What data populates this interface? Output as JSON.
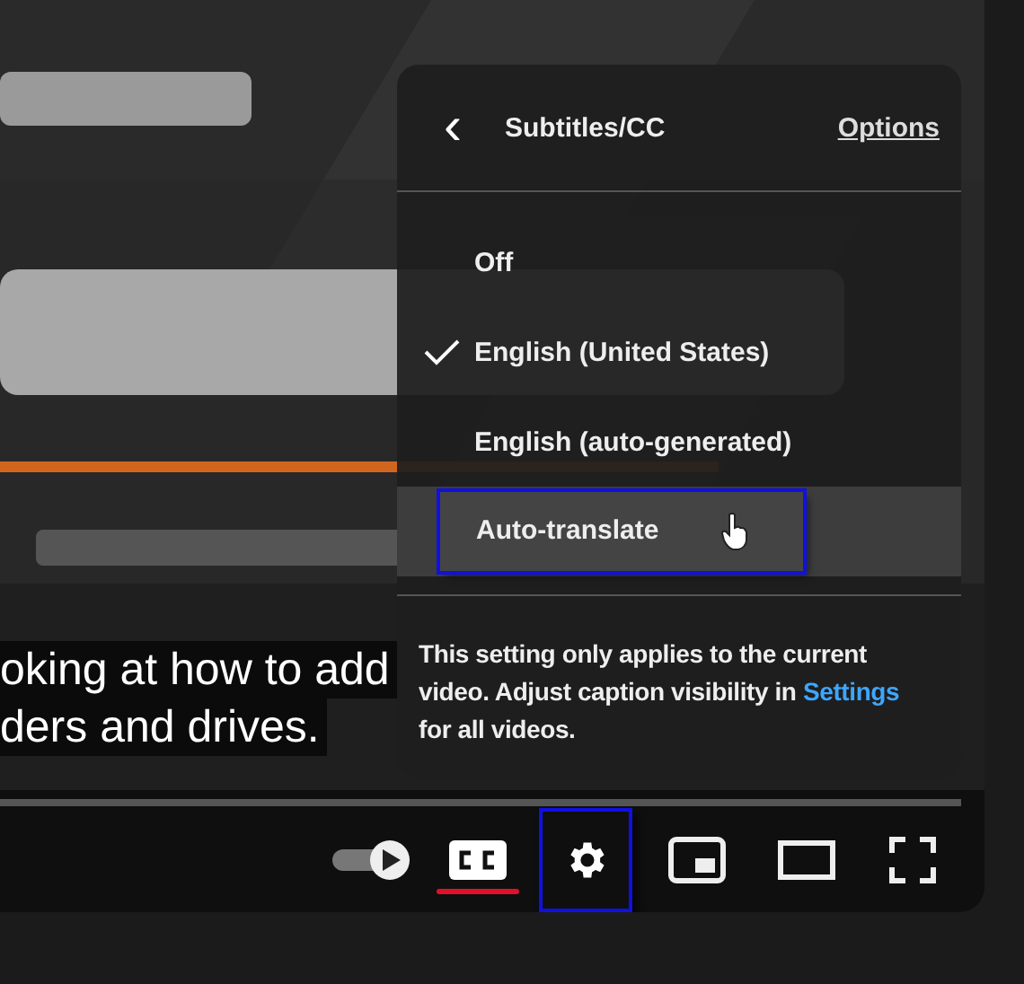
{
  "captions": [
    "oking at how to add",
    "ders and drives."
  ],
  "menu": {
    "back": "‹",
    "title": "Subtitles/CC",
    "options_link": "Options",
    "items": [
      {
        "label": "Off",
        "selected": false,
        "highlighted": false
      },
      {
        "label": "English (United States)",
        "selected": true,
        "highlighted": false
      },
      {
        "label": "English (auto-generated)",
        "selected": false,
        "highlighted": false
      },
      {
        "label": "Auto-translate",
        "selected": false,
        "highlighted": true
      }
    ],
    "note": {
      "before": "This setting only applies to the current video. Adjust caption visibility in ",
      "link": "Settings",
      "after": " for all videos."
    }
  },
  "controls": {
    "captions_on": true,
    "settings_focused": true
  }
}
